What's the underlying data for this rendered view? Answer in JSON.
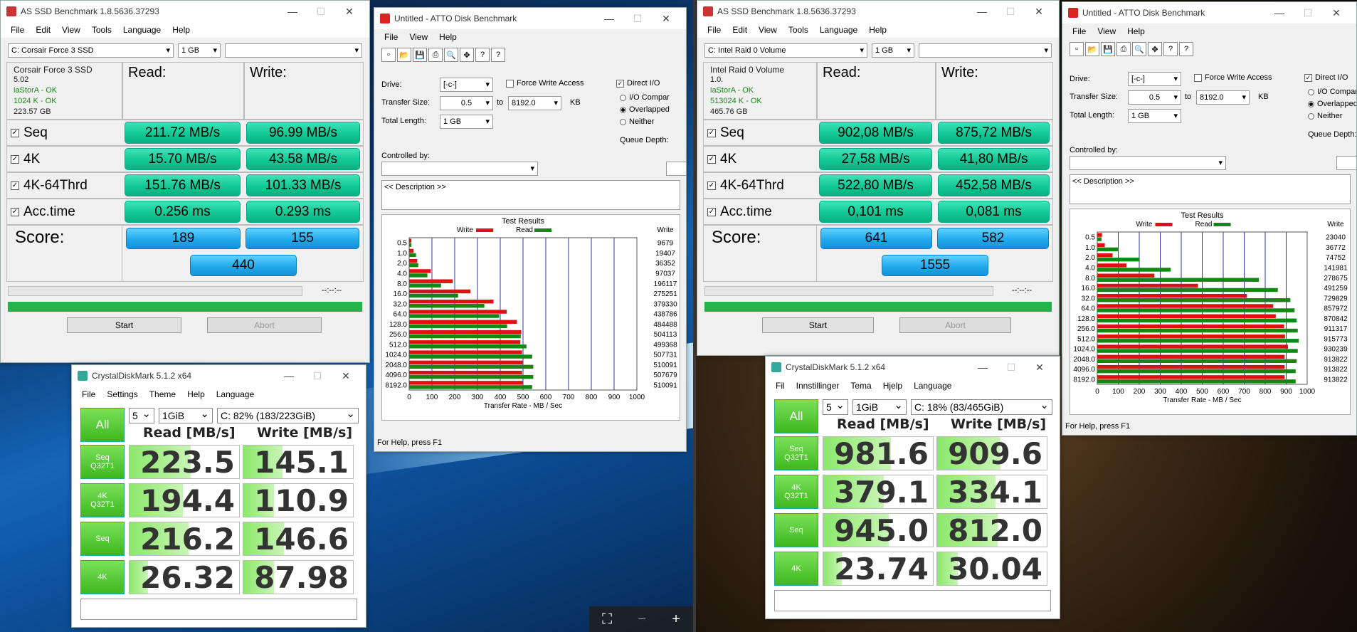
{
  "left": {
    "asssd": {
      "title": "AS SSD Benchmark 1.8.5636.37293",
      "menu": [
        "File",
        "Edit",
        "View",
        "Tools",
        "Language",
        "Help"
      ],
      "drive": "C: Corsair Force 3 SSD",
      "size": "1 GB",
      "info": [
        "Corsair Force 3 SSD",
        "5.02",
        "iaStorA - OK",
        "1024 K - OK",
        "223.57 GB"
      ],
      "read_hdr": "Read:",
      "write_hdr": "Write:",
      "rows": [
        {
          "label": "Seq",
          "read": "211.72 MB/s",
          "write": "96.99 MB/s"
        },
        {
          "label": "4K",
          "read": "15.70 MB/s",
          "write": "43.58 MB/s"
        },
        {
          "label": "4K-64Thrd",
          "read": "151.76 MB/s",
          "write": "101.33 MB/s"
        },
        {
          "label": "Acc.time",
          "read": "0.256 ms",
          "write": "0.293 ms"
        }
      ],
      "score_label": "Score:",
      "score_read": "189",
      "score_write": "155",
      "score_total": "440",
      "time": "--:--:--",
      "start": "Start",
      "abort": "Abort"
    },
    "atto": {
      "title": "Untitled - ATTO Disk Benchmark",
      "menu": [
        "File",
        "View",
        "Help"
      ],
      "drive_label": "Drive:",
      "drive": "[-c-]",
      "force": "Force Write Access",
      "direct": "Direct I/O",
      "ts_label": "Transfer Size:",
      "ts_from": "0.5",
      "to": "to",
      "ts_to": "8192.0",
      "kb": "KB",
      "tl_label": "Total Length:",
      "tl": "1 GB",
      "io": "I/O Compar",
      "overlapped": "Overlapped",
      "neither": "Neither",
      "queue": "Queue Depth:",
      "controlled": "Controlled by:",
      "desc": "<< Description >>",
      "status": "For Help, press F1"
    },
    "cdm": {
      "title": "CrystalDiskMark 5.1.2 x64",
      "menu": [
        "File",
        "Settings",
        "Theme",
        "Help",
        "Language"
      ],
      "runs": "5",
      "size": "1GiB",
      "drive": "C: 82% (183/223GiB)",
      "all": "All",
      "read_hdr": "Read [MB/s]",
      "write_hdr": "Write [MB/s]",
      "rows": [
        {
          "l1": "Seq",
          "l2": "Q32T1",
          "read": "223.5",
          "write": "145.1",
          "rf": 0.56,
          "wf": 0.36
        },
        {
          "l1": "4K",
          "l2": "Q32T1",
          "read": "194.4",
          "write": "110.9",
          "rf": 0.49,
          "wf": 0.28
        },
        {
          "l1": "Seq",
          "l2": "",
          "read": "216.2",
          "write": "146.6",
          "rf": 0.54,
          "wf": 0.37
        },
        {
          "l1": "4K",
          "l2": "",
          "read": "26.32",
          "write": "87.98",
          "rf": 0.17,
          "wf": 0.28
        }
      ]
    }
  },
  "right": {
    "asssd": {
      "title": "AS SSD Benchmark 1.8.5636.37293",
      "menu": [
        "File",
        "Edit",
        "View",
        "Tools",
        "Language",
        "Help"
      ],
      "drive": "C: Intel Raid 0 Volume",
      "size": "1 GB",
      "info": [
        "Intel Raid 0 Volume",
        "1.0.",
        "iaStorA - OK",
        "513024 K - OK",
        "465.76 GB"
      ],
      "read_hdr": "Read:",
      "write_hdr": "Write:",
      "rows": [
        {
          "label": "Seq",
          "read": "902,08 MB/s",
          "write": "875,72 MB/s"
        },
        {
          "label": "4K",
          "read": "27,58 MB/s",
          "write": "41,80 MB/s"
        },
        {
          "label": "4K-64Thrd",
          "read": "522,80 MB/s",
          "write": "452,58 MB/s"
        },
        {
          "label": "Acc.time",
          "read": "0,101 ms",
          "write": "0,081 ms"
        }
      ],
      "score_label": "Score:",
      "score_read": "641",
      "score_write": "582",
      "score_total": "1555",
      "time": "--:--:--",
      "start": "Start",
      "abort": "Abort"
    },
    "atto": {
      "title": "Untitled - ATTO Disk Benchmark",
      "menu": [
        "File",
        "View",
        "Help"
      ],
      "drive_label": "Drive:",
      "drive": "[-c-]",
      "force": "Force Write Access",
      "direct": "Direct I/O",
      "ts_label": "Transfer Size:",
      "ts_from": "0.5",
      "to": "to",
      "ts_to": "8192.0",
      "kb": "KB",
      "tl_label": "Total Length:",
      "tl": "1 GB",
      "io": "I/O Compar",
      "overlapped": "Overlapped",
      "neither": "Neither",
      "queue": "Queue Depth:",
      "controlled": "Controlled by:",
      "desc": "<< Description >>",
      "status": "For Help, press F1"
    },
    "cdm": {
      "title": "CrystalDiskMark 5.1.2 x64",
      "menu": [
        "Fil",
        "Innstillinger",
        "Tema",
        "Hjelp",
        "Language"
      ],
      "runs": "5",
      "size": "1GiB",
      "drive": "C: 18% (83/465GiB)",
      "all": "All",
      "read_hdr": "Read [MB/s]",
      "write_hdr": "Write [MB/s]",
      "rows": [
        {
          "l1": "Seq",
          "l2": "Q32T1",
          "read": "981.6",
          "write": "909.6",
          "rf": 0.62,
          "wf": 0.58
        },
        {
          "l1": "4K",
          "l2": "Q32T1",
          "read": "379.1",
          "write": "334.1",
          "rf": 0.55,
          "wf": 0.53
        },
        {
          "l1": "Seq",
          "l2": "",
          "read": "945.0",
          "write": "812.0",
          "rf": 0.6,
          "wf": 0.55
        },
        {
          "l1": "4K",
          "l2": "",
          "read": "23.74",
          "write": "30.04",
          "rf": 0.17,
          "wf": 0.19
        }
      ]
    }
  },
  "chart_data": [
    {
      "type": "bar",
      "title": "Test Results",
      "xlabel": "Transfer Rate - MB / Sec",
      "xlim": [
        0,
        1000
      ],
      "legend": [
        "Write",
        "Read"
      ],
      "categories": [
        "0.5",
        "1.0",
        "2.0",
        "4.0",
        "8.0",
        "16.0",
        "32.0",
        "64.0",
        "128.0",
        "256.0",
        "512.0",
        "1024.0",
        "2048.0",
        "4096.0",
        "8192.0"
      ],
      "xticks": [
        "0",
        "100",
        "200",
        "300",
        "400",
        "500",
        "600",
        "700",
        "800",
        "900",
        "1000"
      ],
      "col_header": "Write",
      "write_labels": [
        "9679",
        "19407",
        "36352",
        "97037",
        "196117",
        "275251",
        "379330",
        "438786",
        "484488",
        "504113",
        "499368",
        "507731",
        "510091",
        "507679",
        "510091"
      ],
      "series": [
        {
          "name": "Write",
          "color": "#e01010",
          "values": [
            9.5,
            19,
            35.5,
            95,
            191.5,
            268.8,
            370.4,
            428.5,
            473.1,
            492.3,
            487.7,
            495.8,
            498.1,
            495.8,
            498.1
          ]
        },
        {
          "name": "Read",
          "color": "#118811",
          "values": [
            10,
            30,
            40,
            80,
            140,
            215,
            330,
            395,
            430,
            490,
            515,
            540,
            545,
            545,
            540
          ]
        }
      ]
    },
    {
      "type": "bar",
      "title": "Test Results",
      "xlabel": "Transfer Rate - MB / Sec",
      "xlim": [
        0,
        1000
      ],
      "legend": [
        "Write",
        "Read"
      ],
      "categories": [
        "0.5",
        "1.0",
        "2.0",
        "4.0",
        "8.0",
        "16.0",
        "32.0",
        "64.0",
        "128.0",
        "256.0",
        "512.0",
        "1024.0",
        "2048.0",
        "4096.0",
        "8192.0"
      ],
      "xticks": [
        "0",
        "100",
        "200",
        "300",
        "400",
        "500",
        "600",
        "700",
        "800",
        "900",
        "1000"
      ],
      "col_header": "Write",
      "write_labels": [
        "23040",
        "36772",
        "74752",
        "141981",
        "278675",
        "491259",
        "729829",
        "857972",
        "870842",
        "911317",
        "915773",
        "930239",
        "913822",
        "913822",
        "913822"
      ],
      "series": [
        {
          "name": "Write",
          "color": "#e01010",
          "values": [
            22.5,
            35.9,
            73,
            138.7,
            272.1,
            479.7,
            712.7,
            837.9,
            850.4,
            890,
            894.3,
            908.4,
            892.4,
            892.4,
            892.4
          ]
        },
        {
          "name": "Read",
          "color": "#118811",
          "values": [
            20,
            100,
            200,
            350,
            770,
            860,
            920,
            940,
            950,
            955,
            960,
            955,
            950,
            945,
            945
          ]
        }
      ]
    }
  ]
}
